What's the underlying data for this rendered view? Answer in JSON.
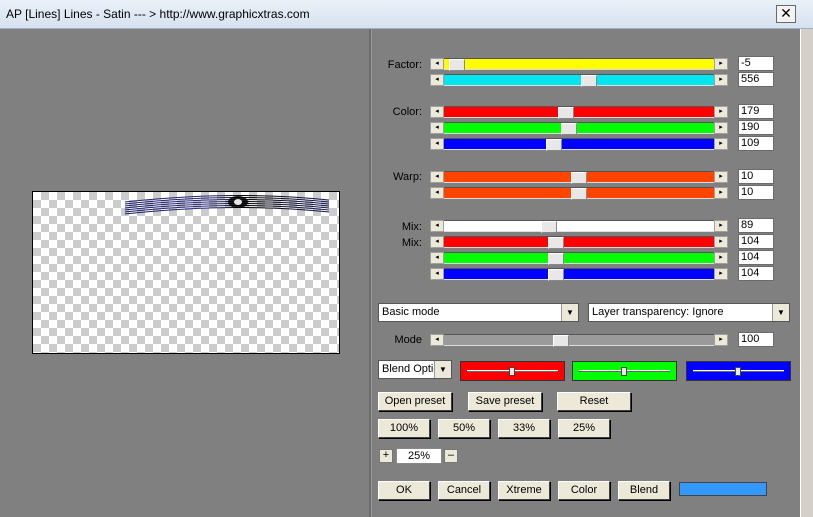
{
  "window": {
    "title": "AP [Lines]  Lines - Satin      --- > http://www.graphicxtras.com",
    "close_label": "✕"
  },
  "labels": {
    "factor": "Factor:",
    "color": "Color:",
    "warp": "Warp:",
    "mix1": "Mix:",
    "mix2": "Mix:",
    "mode": "Mode"
  },
  "sliders": [
    {
      "id": "factor-1",
      "value": "-5",
      "level": 0.02,
      "color": "#ffff00"
    },
    {
      "id": "factor-2",
      "value": "556",
      "level": 0.54,
      "color": "#00e5ee"
    },
    {
      "id": "color-red",
      "value": "179",
      "level": 0.45,
      "color": "#ff0000"
    },
    {
      "id": "color-green",
      "value": "190",
      "level": 0.46,
      "color": "#00ff00"
    },
    {
      "id": "color-blue",
      "value": "109",
      "level": 0.4,
      "color": "#0000ff"
    },
    {
      "id": "warp-1",
      "value": "10",
      "level": 0.5,
      "color": "#ff4400"
    },
    {
      "id": "warp-2",
      "value": "10",
      "level": 0.5,
      "color": "#ff4400"
    },
    {
      "id": "mix-white",
      "value": "89",
      "level": 0.38,
      "color": "#ffffff"
    },
    {
      "id": "mix-red",
      "value": "104",
      "level": 0.41,
      "color": "#ff0000"
    },
    {
      "id": "mix-green",
      "value": "104",
      "level": 0.41,
      "color": "#00ff00"
    },
    {
      "id": "mix-blue",
      "value": "104",
      "level": 0.41,
      "color": "#0000ff"
    },
    {
      "id": "mode",
      "value": "100",
      "level": 0.43,
      "color": "#9a9a9a"
    }
  ],
  "selects": {
    "mode": "Basic mode",
    "transparency": "Layer transparency: Ignore",
    "blend_options": "Blend Optio"
  },
  "blend_boxes": [
    {
      "color": "#ff0000",
      "level": 0.48
    },
    {
      "color": "#00ff00",
      "level": 0.48
    },
    {
      "color": "#0000ff",
      "level": 0.48
    }
  ],
  "buttons": {
    "open_preset": "Open preset",
    "save_preset": "Save preset",
    "reset": "Reset",
    "zoom_100": "100%",
    "zoom_50": "50%",
    "zoom_33": "33%",
    "zoom_25": "25%",
    "ok": "OK",
    "cancel": "Cancel",
    "xtreme": "Xtreme",
    "color": "Color",
    "blend": "Blend"
  },
  "zoom": {
    "plus": "+",
    "value": "25%",
    "minus": "–"
  },
  "swatch_color": "#3399ff",
  "arrows": {
    "left": "◂",
    "right": "▸",
    "down": "▼"
  }
}
